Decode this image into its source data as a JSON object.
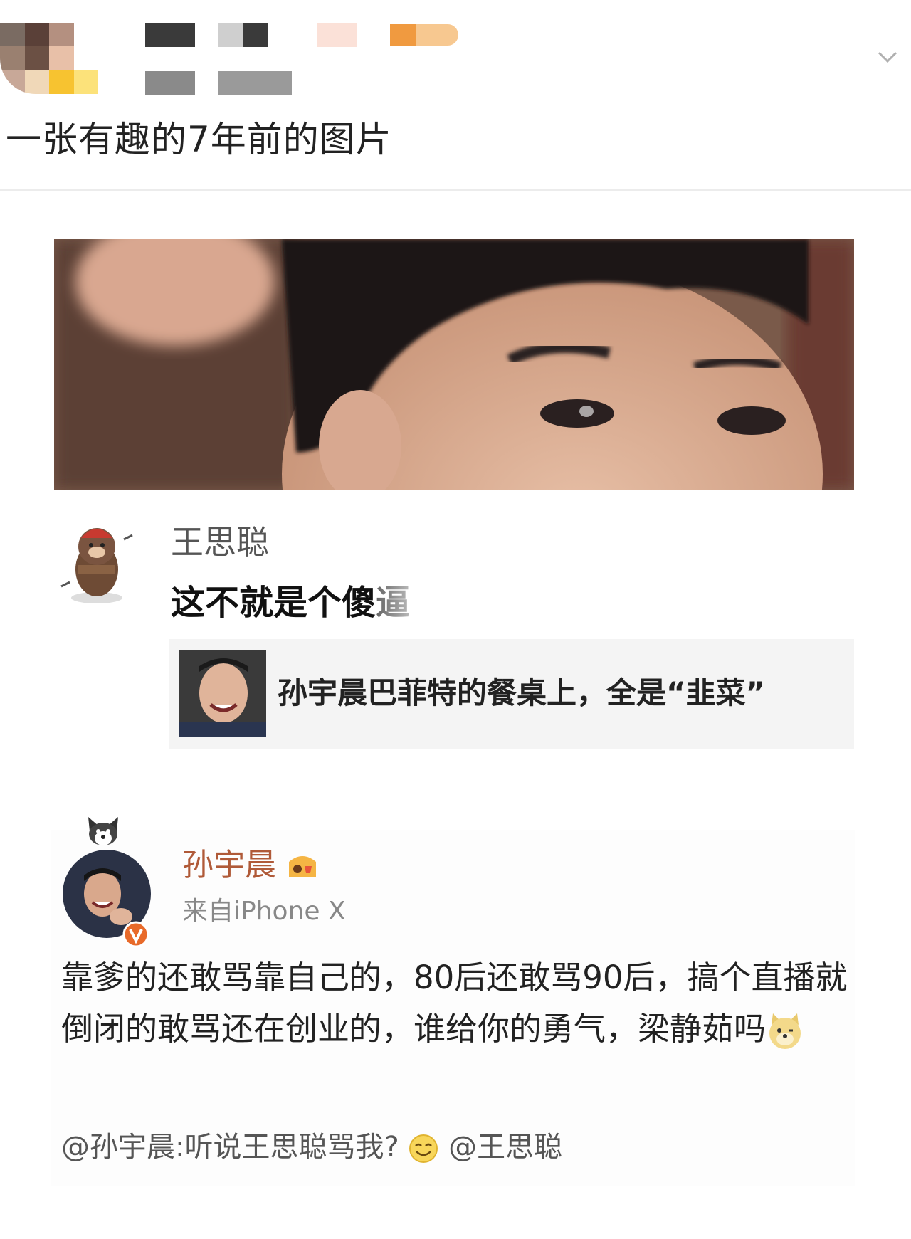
{
  "post": {
    "title": "一张有趣的7年前的图片"
  },
  "comment": {
    "author": "王思聪",
    "text": "这不就是个傻逼",
    "quote_title": "孙宇晨巴菲特的餐桌上，全是“韭菜”"
  },
  "weibo": {
    "author": "孙宇晨",
    "source": "来自iPhone X",
    "body": "靠爹的还敢骂靠自己的，80后还敢骂90后，搞个直播就倒闭的敢骂还在创业的，谁给你的勇气，梁静茹吗",
    "mention_prefix": "@孙宇晨:听说王思聪骂我?",
    "mention_target": "@王思聪"
  },
  "icons": [
    "chevron-down-icon",
    "verified-badge-icon",
    "doge-emoji",
    "smile-emoji",
    "vip-badge-icon"
  ],
  "colors": {
    "weibo_name": "#b05a38",
    "verified_badge": "#e86a2a",
    "separator": "#ececec"
  }
}
